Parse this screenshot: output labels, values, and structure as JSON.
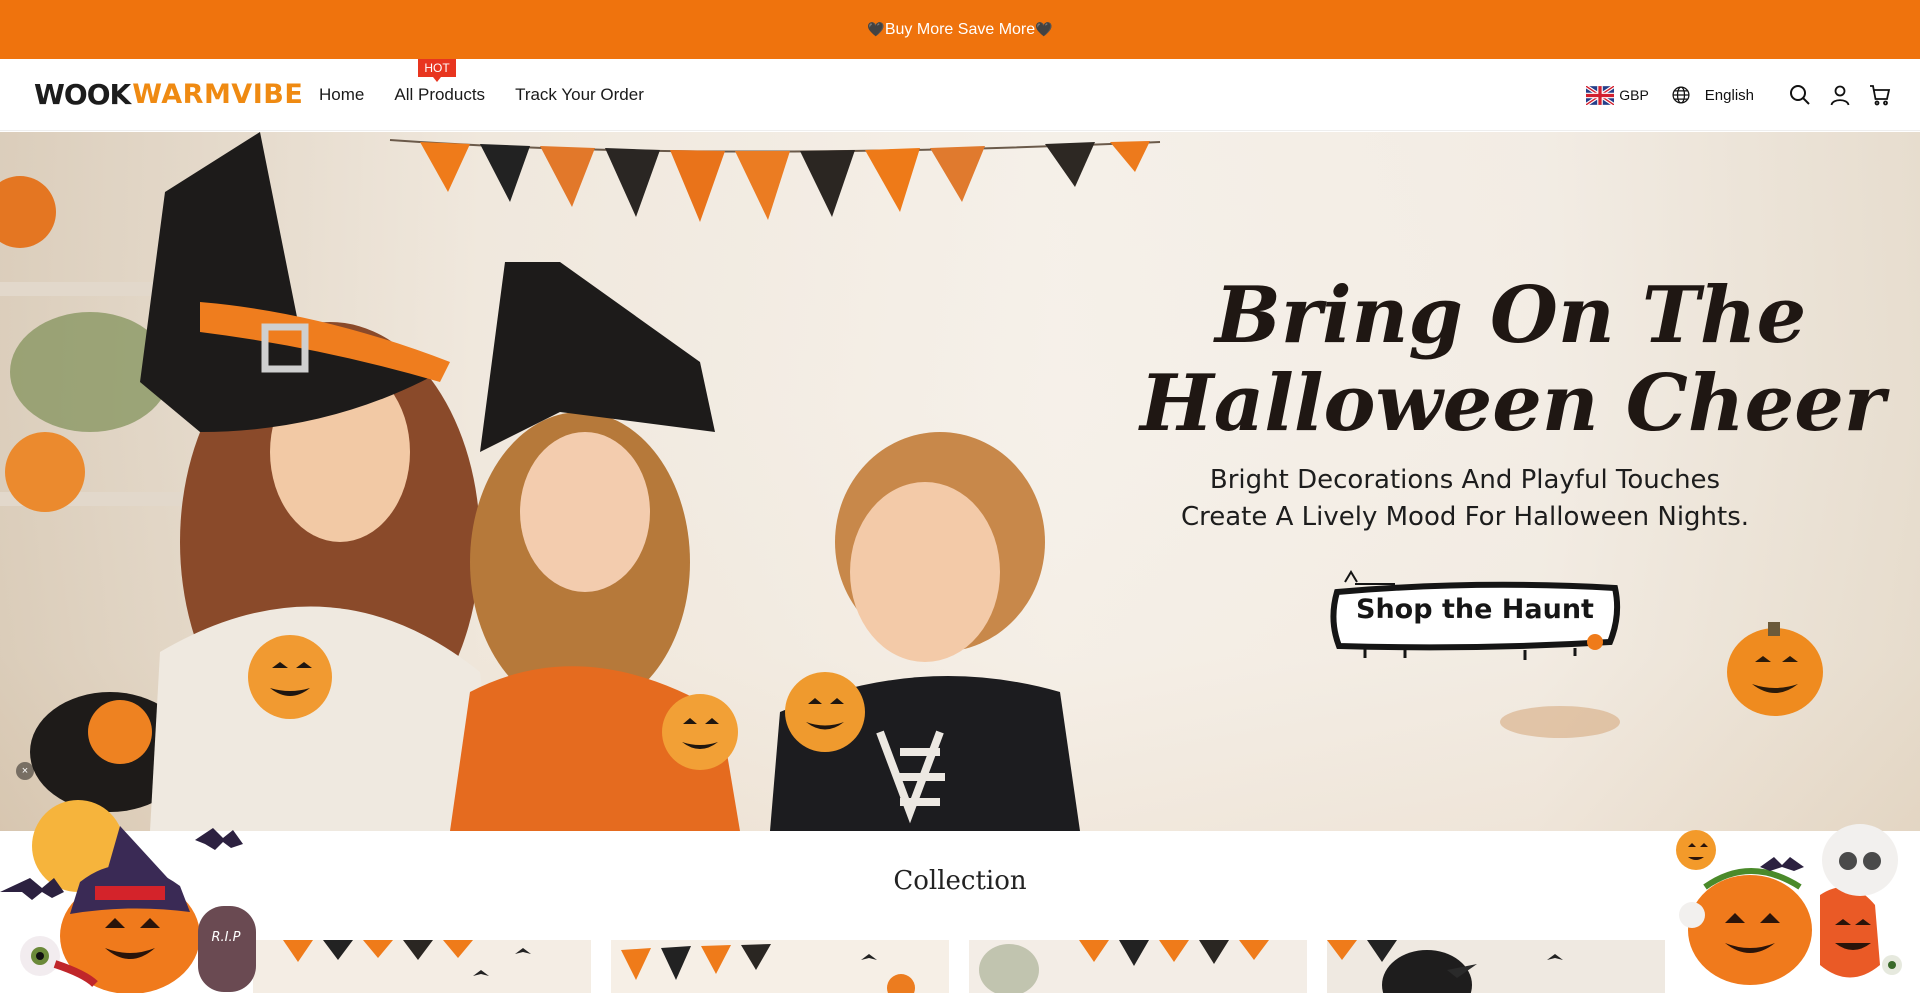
{
  "announcement": {
    "text": "Buy More Save More",
    "heart": "🖤"
  },
  "header": {
    "logo_mark": "WOOK",
    "logo_word": "WARMVIBE",
    "nav": [
      {
        "label": "Home"
      },
      {
        "label": "All Products",
        "badge": "HOT"
      },
      {
        "label": "Track Your Order"
      }
    ],
    "currency": "GBP",
    "language": "English",
    "icons": [
      "globe-icon",
      "search-icon",
      "account-icon",
      "cart-icon"
    ]
  },
  "hero": {
    "title_line1": "Bring On The",
    "title_line2": "Halloween Cheer",
    "subtitle_line1": "Bright Decorations And Playful Touches",
    "subtitle_line2": "Create A Lively Mood For Halloween Nights.",
    "cta": "Shop the Haunt",
    "close_symbol": "×"
  },
  "collection": {
    "title": "Collection"
  },
  "decor": {
    "tombstone_text": "R.I.P"
  },
  "colors": {
    "accent": "#ef730d",
    "logo_orange": "#ef8a12",
    "badge_red": "#e8351f"
  }
}
